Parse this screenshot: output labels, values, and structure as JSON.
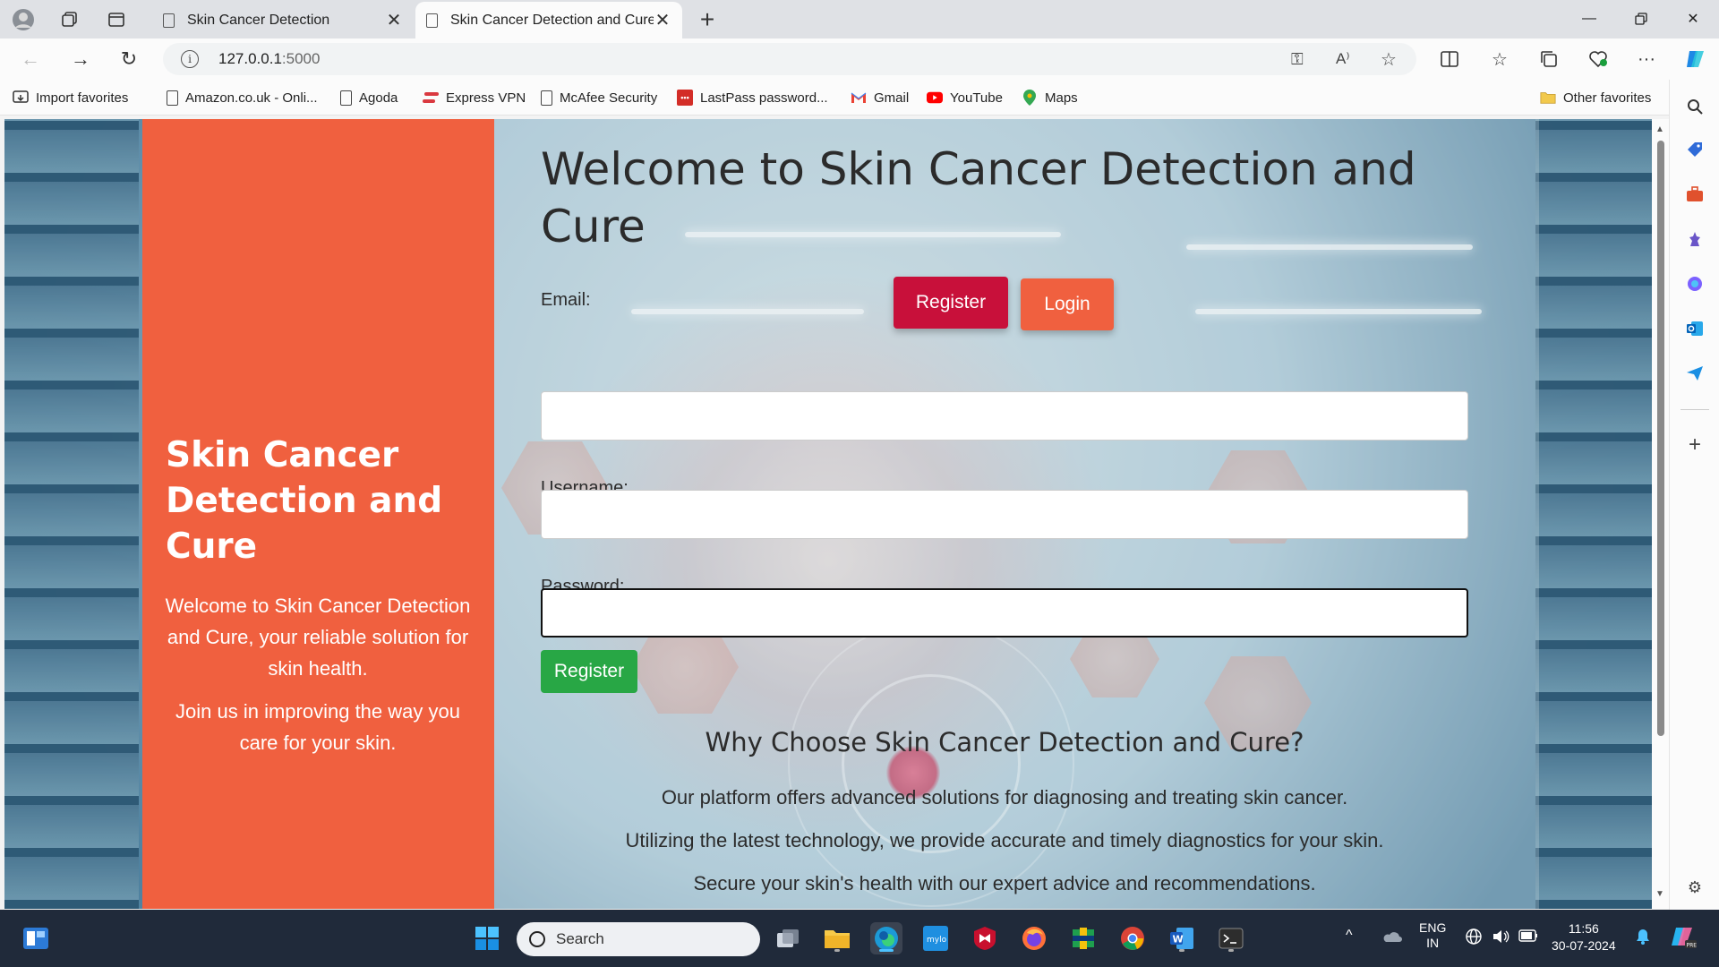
{
  "browser": {
    "tabs": [
      {
        "title": "Skin Cancer Detection",
        "active": false
      },
      {
        "title": "Skin Cancer Detection and Cure",
        "active": true
      }
    ],
    "url_host": "127.0.0.1",
    "url_port": ":5000",
    "favorites": [
      {
        "label": "Import favorites",
        "icon": "import-icon"
      },
      {
        "label": "Amazon.co.uk - Onli...",
        "icon": "page-icon"
      },
      {
        "label": "Agoda",
        "icon": "page-icon"
      },
      {
        "label": "Express VPN",
        "icon": "expressvpn-icon"
      },
      {
        "label": "McAfee Security",
        "icon": "page-icon"
      },
      {
        "label": "LastPass password...",
        "icon": "lastpass-icon"
      },
      {
        "label": "Gmail",
        "icon": "gmail-icon"
      },
      {
        "label": "YouTube",
        "icon": "youtube-icon"
      },
      {
        "label": "Maps",
        "icon": "maps-icon"
      }
    ],
    "other_favorites": "Other favorites"
  },
  "page": {
    "sidebar_title": "Skin Cancer Detection and Cure",
    "sidebar_p1": "Welcome to Skin Cancer Detection and Cure, your reliable solution for skin health.",
    "sidebar_p2": "Join us in improving the way you care for your skin.",
    "heading": "Welcome to Skin Cancer Detection and Cure",
    "register_tab": "Register",
    "login_tab": "Login",
    "email_label": "Email:",
    "username_label": "Username:",
    "password_label": "Password:",
    "email_value": "",
    "username_value": "",
    "password_value": "",
    "submit_label": "Register",
    "why_title": "Why Choose Skin Cancer Detection and Cure?",
    "why_lines": [
      "Our platform offers advanced solutions for diagnosing and treating skin cancer.",
      "Utilizing the latest technology, we provide accurate and timely diagnostics for your skin.",
      "Secure your skin's health with our expert advice and recommendations."
    ]
  },
  "taskbar": {
    "search_placeholder": "Search",
    "lang_top": "ENG",
    "lang_bottom": "IN",
    "time": "11:56",
    "date": "30-07-2024"
  },
  "colors": {
    "left_panel": "#f0603f",
    "register_tab": "#c8103a",
    "login_tab": "#f0603f",
    "submit": "#28a745"
  }
}
